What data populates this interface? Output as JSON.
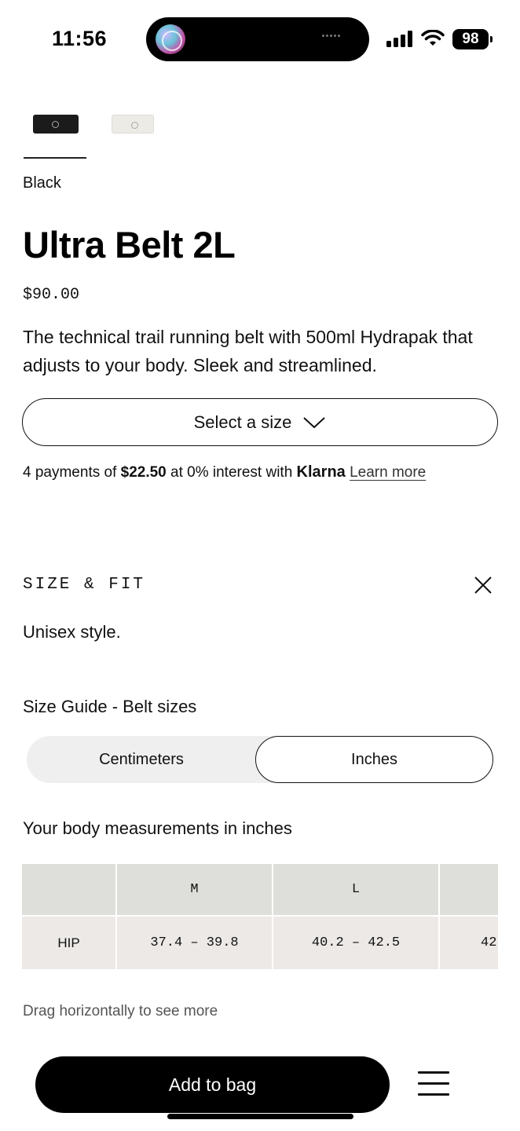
{
  "status_bar": {
    "time": "11:56",
    "battery": "98",
    "icons": [
      "app-activity-icon",
      "signal-icon",
      "wifi-icon",
      "battery-icon"
    ]
  },
  "product": {
    "swatches": [
      {
        "name": "Black",
        "selected": true
      },
      {
        "name": "White",
        "selected": false
      }
    ],
    "color_label": "Black",
    "title": "Ultra Belt 2L",
    "price": "$90.00",
    "description": "The technical trail running belt with 500ml Hydrapak that adjusts to your body. Sleek and streamlined."
  },
  "size_select": {
    "label": "Select a size",
    "icon": "chevron-down-icon"
  },
  "klarna": {
    "prefix": "4 payments of ",
    "amount": "$22.50",
    "middle": " at 0% interest with ",
    "brand": "Klarna",
    "link": "Learn more"
  },
  "size_fit": {
    "heading": "SIZE & FIT",
    "note": "Unisex style.",
    "guide_title": "Size Guide - Belt sizes",
    "units": [
      {
        "label": "Centimeters",
        "selected": false
      },
      {
        "label": "Inches",
        "selected": true
      }
    ],
    "measurements_label": "Your body measurements in inches",
    "table": {
      "columns": [
        "",
        "M",
        "L",
        ""
      ],
      "rows": [
        {
          "label": "HIP",
          "values": [
            "37.4 – 39.8",
            "40.2 – 42.5",
            "42"
          ]
        }
      ]
    },
    "drag_hint": "Drag horizontally to see more"
  },
  "footer": {
    "add_to_bag": "Add to bag",
    "menu_icon": "menu-icon"
  },
  "colors": {
    "primary": "#000000",
    "toggle_bg": "#efefef",
    "table_header_bg": "#dededb",
    "table_row_bg": "#ece9e7"
  }
}
